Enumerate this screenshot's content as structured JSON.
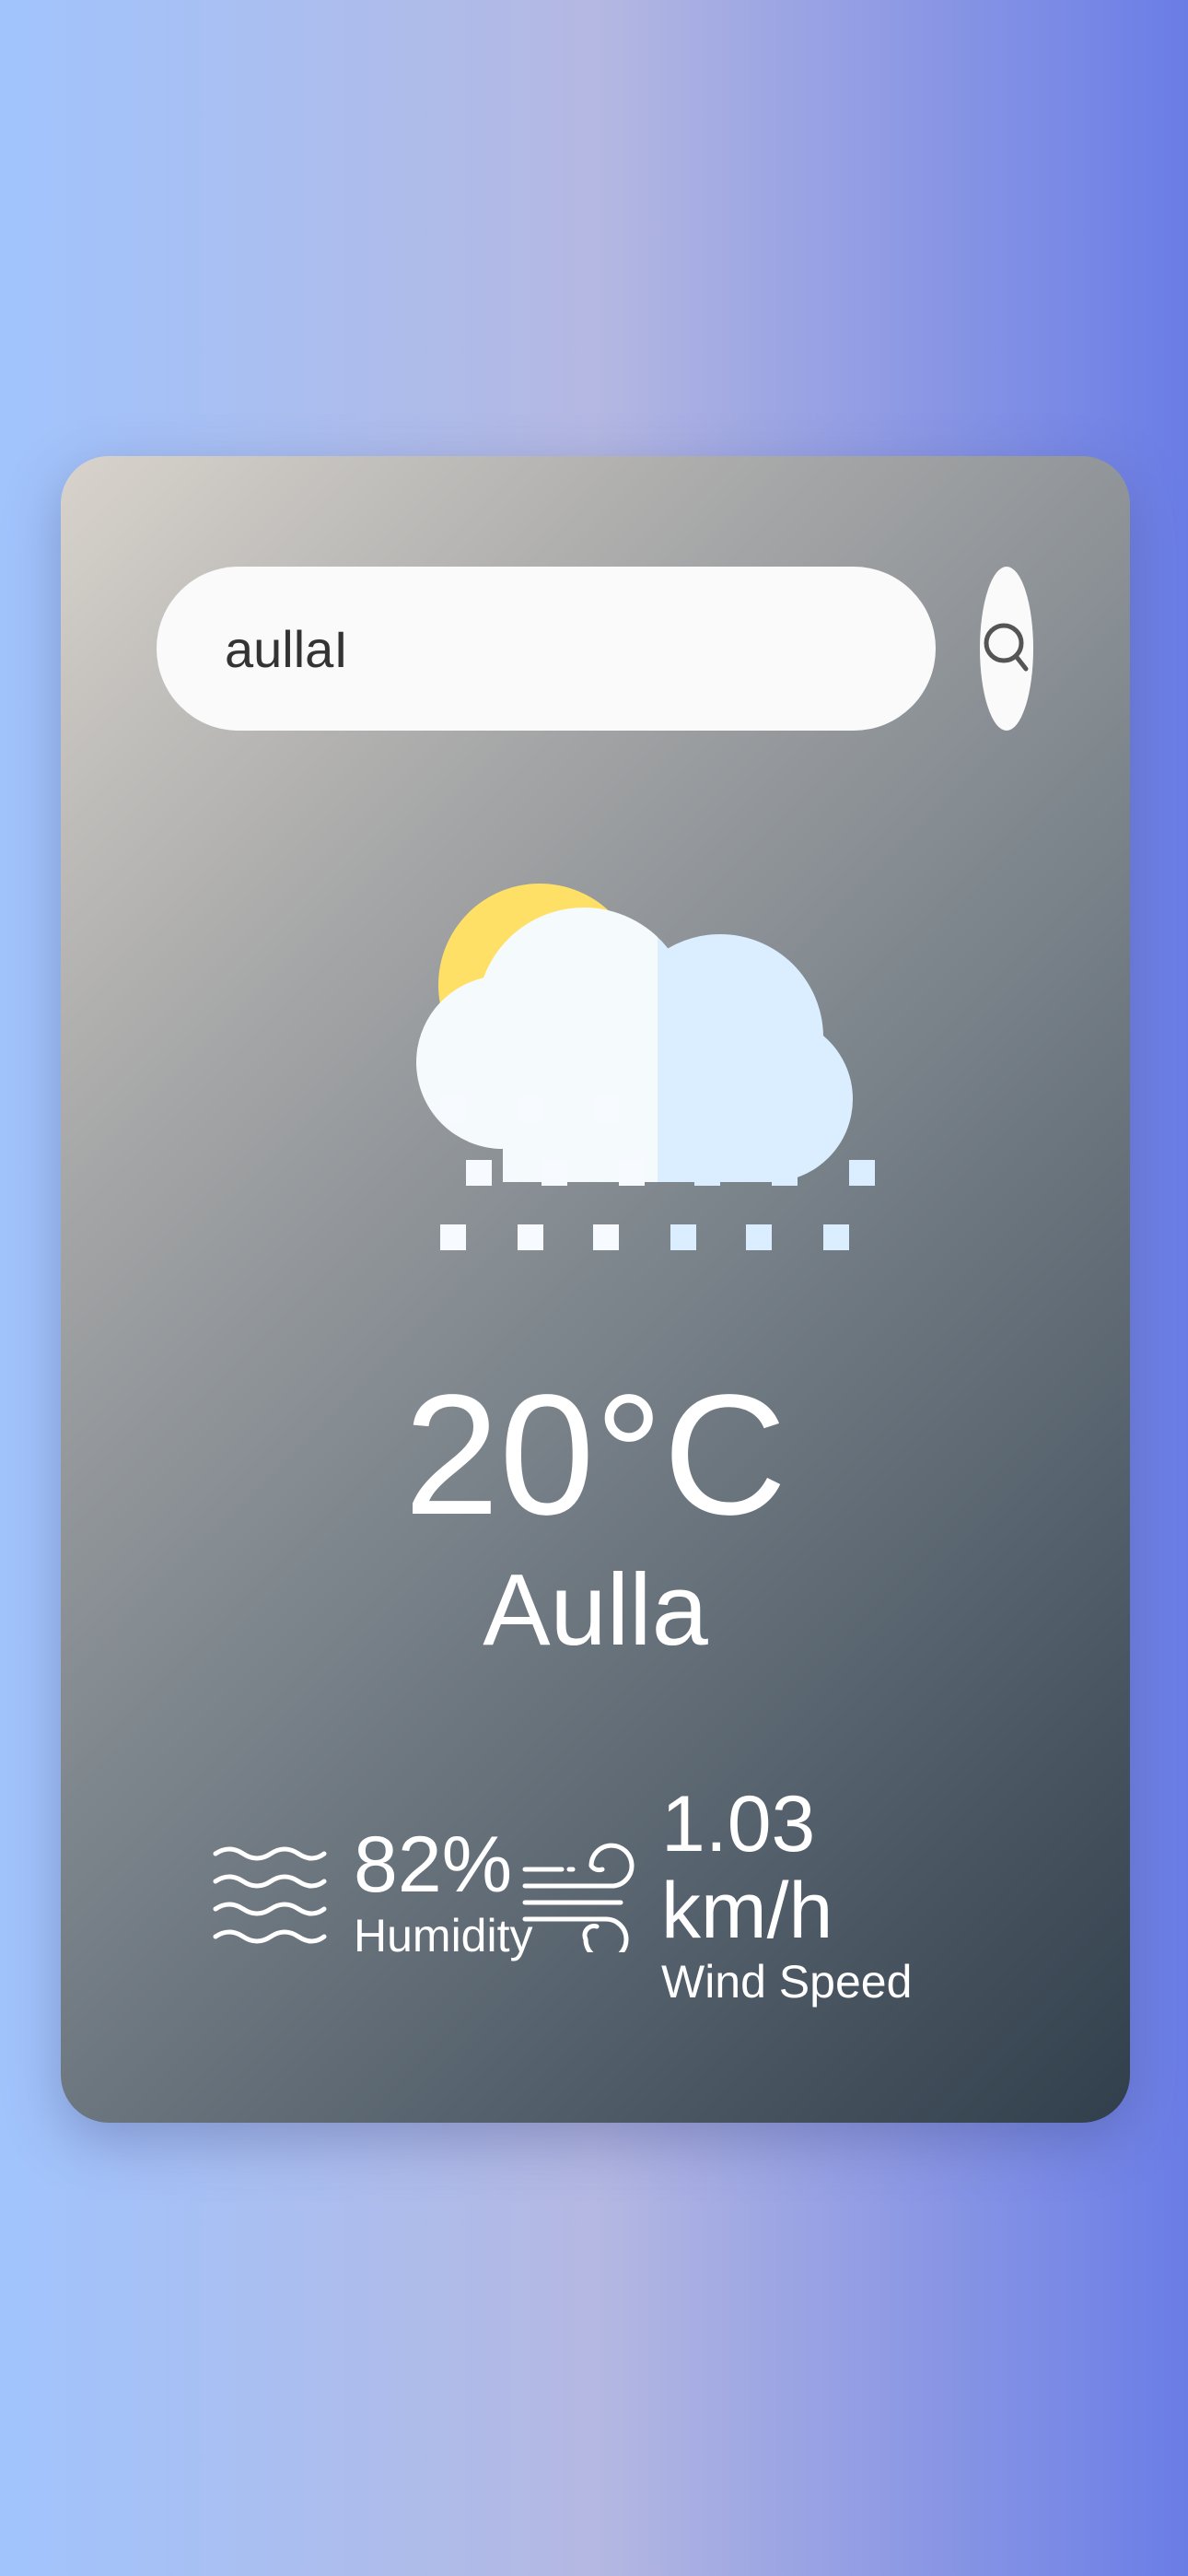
{
  "search": {
    "value": "aullaI"
  },
  "weather": {
    "condition_icon": "sun-cloud-snow-icon",
    "temperature": "20°C",
    "city": "Aulla"
  },
  "humidity": {
    "icon": "humidity-waves-icon",
    "value": "82%",
    "label": "Humidity"
  },
  "wind": {
    "icon": "wind-icon",
    "value": "1.03 km/h",
    "label": "Wind Speed"
  },
  "colors": {
    "background_start": "#a1c4fd",
    "background_end": "#6a7de6",
    "sun": "#ffe066",
    "cloud_light": "#f5fafd",
    "cloud_shade": "#dbeeff",
    "text": "#ffffff"
  }
}
